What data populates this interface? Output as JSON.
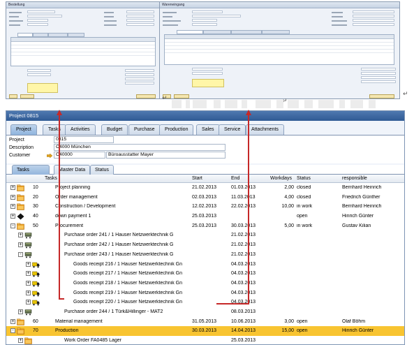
{
  "top_left_window": {
    "title": "Bestellung"
  },
  "top_right_window": {
    "title": "Wareneingang"
  },
  "window": {
    "title": "Project 0815"
  },
  "tabs": [
    {
      "label": "Project",
      "active": true
    },
    {
      "label": "Tasks",
      "active": false
    },
    {
      "label": "Activities",
      "active": false
    },
    {
      "label": "Budget",
      "active": false
    },
    {
      "label": "Purchase",
      "active": false
    },
    {
      "label": "Production",
      "active": false
    },
    {
      "label": "Sales",
      "active": false
    },
    {
      "label": "Service",
      "active": false
    },
    {
      "label": "Attachments",
      "active": false
    }
  ],
  "fields": {
    "project_label": "Project",
    "project_value": "0815",
    "description_label": "Description",
    "description_value": "C4000 München",
    "customer_label": "Customer",
    "customer_code": "C40000",
    "customer_name": "Büroausstatter Mayer"
  },
  "subtabs": [
    {
      "label": "Tasks",
      "active": true
    },
    {
      "label": "Master Data",
      "active": false
    },
    {
      "label": "Status",
      "active": false
    }
  ],
  "columns": {
    "tasks": "Tasks",
    "start": "Start",
    "end": "End",
    "workdays": "Workdays",
    "status": "Status",
    "responsible": "responsible"
  },
  "rows": [
    {
      "level": 0,
      "toggle": "+",
      "icon": "folder",
      "num": "10",
      "task": "Project planning",
      "start": "21.02.2013",
      "end": "01.03.2013",
      "workdays": "2,00",
      "status": "closed",
      "responsible": "Bernhard Heinrich",
      "selected": false
    },
    {
      "level": 0,
      "toggle": "+",
      "icon": "folder",
      "num": "20",
      "task": "Order management",
      "start": "02.03.2013",
      "end": "11.03.2013",
      "workdays": "4,00",
      "status": "closed",
      "responsible": "Friedrich Günther",
      "selected": false
    },
    {
      "level": 0,
      "toggle": "+",
      "icon": "folder",
      "num": "30",
      "task": "Construction / Development",
      "start": "12.02.2013",
      "end": "22.02.2013",
      "workdays": "10,00",
      "status": "in work",
      "responsible": "Bernhard Heinrich",
      "selected": false
    },
    {
      "level": 0,
      "toggle": "+",
      "icon": "diamond",
      "num": "40",
      "task": "down payment 1",
      "start": "25.03.2013",
      "end": "",
      "workdays": "",
      "status": "open",
      "responsible": "Hinrich Günter",
      "selected": false
    },
    {
      "level": 0,
      "toggle": "-",
      "icon": "folder",
      "num": "50",
      "task": "Procurement",
      "start": "25.03.2013",
      "end": "30.03.2013",
      "workdays": "5,00",
      "status": "in work",
      "responsible": "Gustav Kilian",
      "selected": false
    },
    {
      "level": 1,
      "toggle": "+",
      "icon": "cart",
      "num": "",
      "task": "Purchase order 241 / 1  Hauser Netzwerktechnik G",
      "start": "",
      "end": "21.02.2013",
      "workdays": "",
      "status": "",
      "responsible": "",
      "selected": false
    },
    {
      "level": 1,
      "toggle": "+",
      "icon": "cart",
      "num": "",
      "task": "Purchase order 242 / 1  Hauser Netzwerktechnik G",
      "start": "",
      "end": "21.02.2013",
      "workdays": "",
      "status": "",
      "responsible": "",
      "selected": false
    },
    {
      "level": 1,
      "toggle": "-",
      "icon": "cart",
      "num": "",
      "task": "Purchase order 243 / 1  Hauser Netzwerktechnik G",
      "start": "",
      "end": "21.02.2013",
      "workdays": "",
      "status": "",
      "responsible": "",
      "selected": false
    },
    {
      "level": 2,
      "toggle": "+",
      "icon": "truck",
      "num": "",
      "task": "Goods receipt 216 / 1  Hauser Netzwerktechnik Gn",
      "start": "",
      "end": "04.03.2013",
      "workdays": "",
      "status": "",
      "responsible": "",
      "selected": false
    },
    {
      "level": 2,
      "toggle": "+",
      "icon": "truck",
      "num": "",
      "task": "Goods receipt 217 / 1  Hauser Netzwerktechnik Gn",
      "start": "",
      "end": "04.03.2013",
      "workdays": "",
      "status": "",
      "responsible": "",
      "selected": false
    },
    {
      "level": 2,
      "toggle": "+",
      "icon": "truck",
      "num": "",
      "task": "Goods receipt 218 / 1  Hauser Netzwerktechnik Gn",
      "start": "",
      "end": "04.03.2013",
      "workdays": "",
      "status": "",
      "responsible": "",
      "selected": false
    },
    {
      "level": 2,
      "toggle": "+",
      "icon": "truck",
      "num": "",
      "task": "Goods receipt 219 / 1  Hauser Netzwerktechnik Gn",
      "start": "",
      "end": "04.03.2013",
      "workdays": "",
      "status": "",
      "responsible": "",
      "selected": false
    },
    {
      "level": 2,
      "toggle": "+",
      "icon": "truck",
      "num": "",
      "task": "Goods receipt 220 / 1  Hauser Netzwerktechnik Gn",
      "start": "",
      "end": "04.03.2013",
      "workdays": "",
      "status": "",
      "responsible": "",
      "selected": false
    },
    {
      "level": 1,
      "toggle": "+",
      "icon": "cart",
      "num": "",
      "task": "Purchase order 244 / 1  Türk&Hillinger - MAT2",
      "start": "",
      "end": "08.03.2013",
      "workdays": "",
      "status": "",
      "responsible": "",
      "selected": false
    },
    {
      "level": 0,
      "toggle": "+",
      "icon": "folder",
      "num": "60",
      "task": "Material management",
      "start": "31.05.2013",
      "end": "10.06.2013",
      "workdays": "3,00",
      "status": "open",
      "responsible": "Olaf Böhm",
      "selected": false
    },
    {
      "level": 0,
      "toggle": "-",
      "icon": "folder",
      "num": "70",
      "task": "Production",
      "start": "30.03.2013",
      "end": "14.04.2013",
      "workdays": "15,00",
      "status": "open",
      "responsible": "Hinrich Günter",
      "selected": true
    },
    {
      "level": 1,
      "toggle": "+",
      "icon": "folder",
      "num": "",
      "task": "Work Order FA0485 Lager",
      "start": "",
      "end": "25.03.2013",
      "workdays": "",
      "status": "",
      "responsible": "",
      "selected": false
    }
  ],
  "colors": {
    "selected_row": "#f8c431",
    "annotation": "#c62828",
    "title_bar": "#3a659f"
  }
}
